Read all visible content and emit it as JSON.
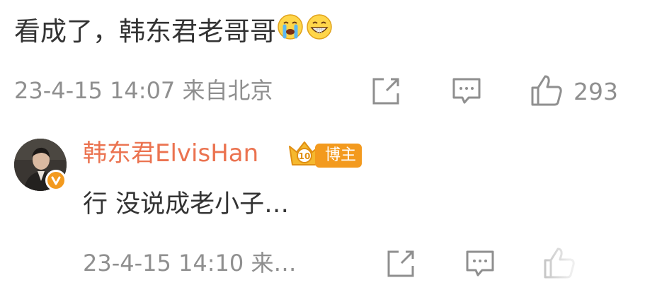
{
  "comment": {
    "text": "看成了，韩东君老哥哥",
    "emojis": [
      "crying-emoji",
      "grinning-emoji"
    ],
    "timestamp": "23-4-15 14:07",
    "location": "来自北京",
    "like_count": "293"
  },
  "reply": {
    "author": "韩东君ElvisHan",
    "badge": "博主",
    "badge_level": "10",
    "text": "行 没说成老小子…",
    "timestamp": "23-4-15 14:10",
    "location": "来…"
  },
  "colors": {
    "author": "#eb7350",
    "meta": "#8f8f8f",
    "badge": "#f39a1e",
    "text": "#333333"
  }
}
